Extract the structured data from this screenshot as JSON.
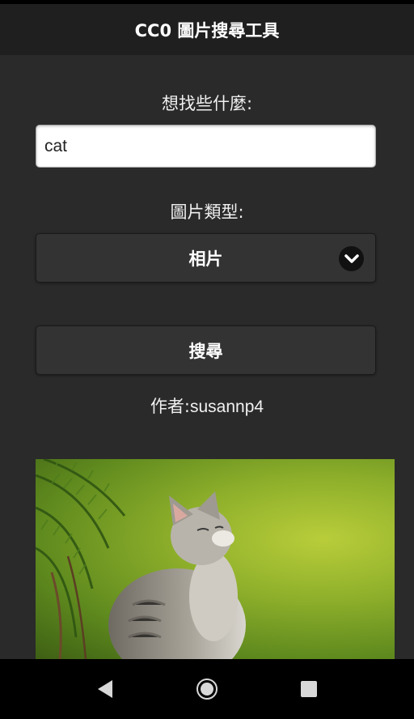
{
  "app": {
    "title": "CC0 圖片搜尋工具"
  },
  "search": {
    "query_label": "想找些什麼:",
    "query_value": "cat",
    "type_label": "圖片類型:",
    "type_selected": "相片",
    "button_label": "搜尋"
  },
  "result": {
    "author_prefix": "作者:",
    "author_name": "susannp4",
    "image_subject": "kitten-sitting-in-grass"
  },
  "icons": {
    "select": "chevron-down-icon",
    "nav_back": "back-triangle-icon",
    "nav_home": "home-circle-icon",
    "nav_recents": "recents-square-icon"
  },
  "colors": {
    "background": "#2a2a2a",
    "header": "#1f1f1f",
    "button": "#333333",
    "text": "#ffffff"
  }
}
